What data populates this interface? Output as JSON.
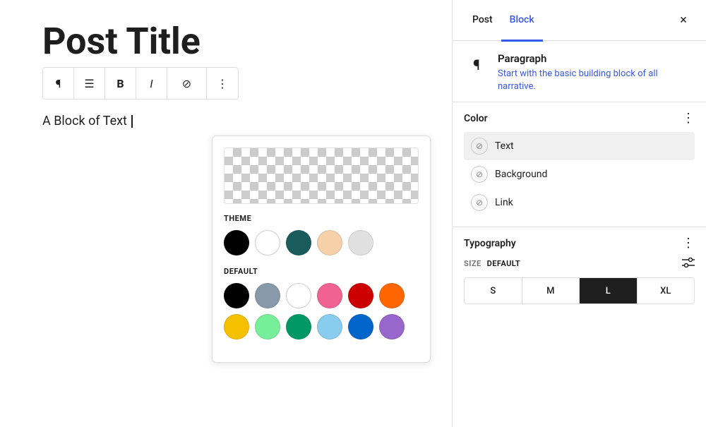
{
  "editor": {
    "post_title": "Post Title",
    "block_text": "A Block of Text",
    "toolbar": {
      "paragraph_icon": "¶",
      "align_icon": "≡",
      "bold_label": "B",
      "italic_label": "I",
      "link_label": "⊘",
      "chevron_label": "∨",
      "more_label": "⋮"
    }
  },
  "color_picker": {
    "theme_label": "THEME",
    "default_label": "DEFAULT",
    "theme_colors": [
      {
        "name": "black",
        "hex": "#000000"
      },
      {
        "name": "white",
        "hex": "#ffffff",
        "is_white": true
      },
      {
        "name": "teal",
        "hex": "#1a5c5c"
      },
      {
        "name": "peach",
        "hex": "#f5d0a9"
      },
      {
        "name": "light-gray",
        "hex": "#e0e0e0",
        "is_white": true
      }
    ],
    "default_colors": [
      {
        "name": "black",
        "hex": "#000000"
      },
      {
        "name": "gray-blue",
        "hex": "#8899aa"
      },
      {
        "name": "white",
        "hex": "#ffffff",
        "is_white": true
      },
      {
        "name": "pink",
        "hex": "#f06292"
      },
      {
        "name": "red",
        "hex": "#cc0000"
      },
      {
        "name": "orange",
        "hex": "#ff6600"
      },
      {
        "name": "yellow",
        "hex": "#f5c000"
      },
      {
        "name": "mint",
        "hex": "#77ee99"
      },
      {
        "name": "green",
        "hex": "#009966"
      },
      {
        "name": "light-blue",
        "hex": "#88ccee"
      },
      {
        "name": "blue",
        "hex": "#0066cc"
      },
      {
        "name": "purple",
        "hex": "#9966cc"
      }
    ]
  },
  "panel": {
    "tabs": [
      {
        "id": "post",
        "label": "Post"
      },
      {
        "id": "block",
        "label": "Block"
      }
    ],
    "active_tab": "block",
    "close_label": "×",
    "block": {
      "icon": "¶",
      "name": "Paragraph",
      "description": "Start with the basic building block of all narrative."
    },
    "color_section": {
      "title": "Color",
      "more_icon": "⋮",
      "rows": [
        {
          "id": "text",
          "label": "Text",
          "highlighted": true
        },
        {
          "id": "background",
          "label": "Background",
          "highlighted": false
        },
        {
          "id": "link",
          "label": "Link",
          "highlighted": false
        }
      ]
    },
    "typography_section": {
      "title": "Typography",
      "more_icon": "⋮",
      "size_label": "SIZE",
      "size_default": "DEFAULT",
      "size_options": [
        {
          "label": "S",
          "active": false
        },
        {
          "label": "M",
          "active": false
        },
        {
          "label": "L",
          "active": true
        },
        {
          "label": "XL",
          "active": false
        }
      ]
    }
  },
  "colors": {
    "accent_blue": "#3858e9"
  }
}
